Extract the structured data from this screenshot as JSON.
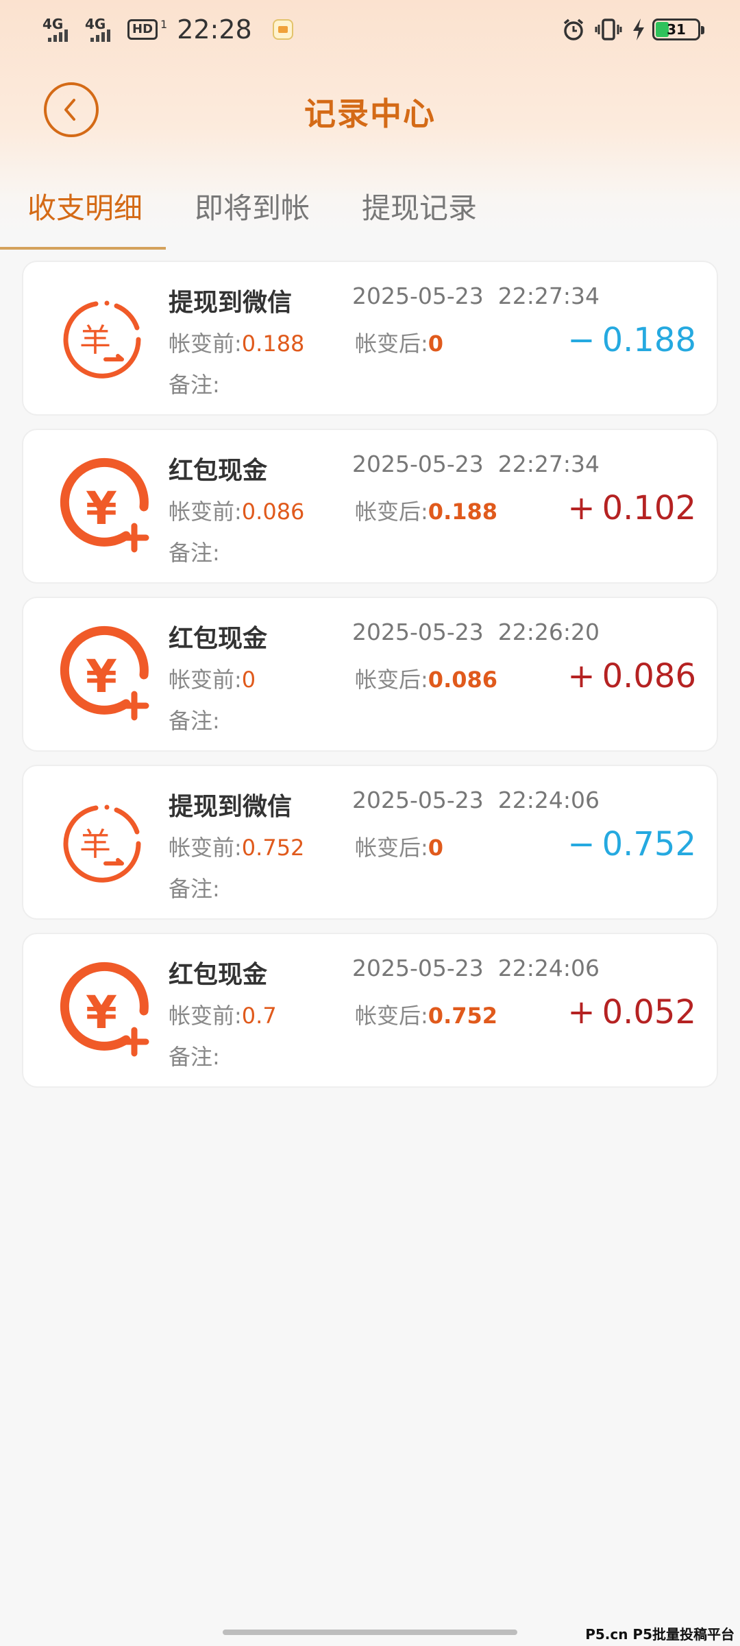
{
  "status_bar": {
    "signal1": "4G",
    "signal2": "4G",
    "hd": "HD",
    "hd_sub": "1",
    "time": "22:28",
    "battery": "31"
  },
  "header": {
    "title": "记录中心"
  },
  "tabs": [
    {
      "label": "收支明细",
      "active": true
    },
    {
      "label": "即将到帐",
      "active": false
    },
    {
      "label": "提现记录",
      "active": false
    }
  ],
  "labels": {
    "before": "帐变前:",
    "after": "帐变后:",
    "note": "备注:"
  },
  "records": [
    {
      "title": "提现到微信",
      "time": "2025-05-23  22:27:34",
      "before": "0.188",
      "after": "0",
      "sign": "−",
      "amount": "0.188",
      "type": "minus"
    },
    {
      "title": "红包现金",
      "time": "2025-05-23  22:27:34",
      "before": "0.086",
      "after": "0.188",
      "sign": "+",
      "amount": "0.102",
      "type": "plus"
    },
    {
      "title": "红包现金",
      "time": "2025-05-23  22:26:20",
      "before": "0",
      "after": "0.086",
      "sign": "+",
      "amount": "0.086",
      "type": "plus"
    },
    {
      "title": "提现到微信",
      "time": "2025-05-23  22:24:06",
      "before": "0.752",
      "after": "0",
      "sign": "−",
      "amount": "0.752",
      "type": "minus"
    },
    {
      "title": "红包现金",
      "time": "2025-05-23  22:24:06",
      "before": "0.7",
      "after": "0.752",
      "sign": "+",
      "amount": "0.052",
      "type": "plus"
    }
  ],
  "watermark": "P5.cn P5批量投稿平台",
  "colors": {
    "accent": "#d46a16",
    "icon_orange": "#f05a28",
    "minus_blue": "#25a9e0",
    "plus_red": "#b52222"
  }
}
